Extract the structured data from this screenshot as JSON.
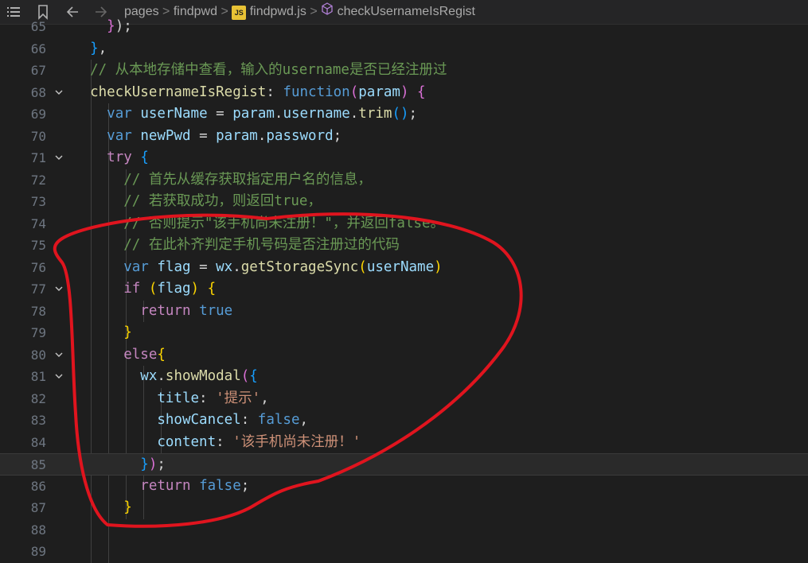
{
  "breadcrumb": {
    "items": [
      "pages",
      "findpwd",
      "findpwd.js",
      "checkUsernameIsRegist"
    ],
    "js_badge": "JS"
  },
  "editor": {
    "current_line": 85,
    "lines": [
      {
        "n": 65,
        "fold": false,
        "tokens": [
          [
            "punc",
            "    "
          ],
          [
            "br1",
            "}"
          ],
          [
            "punc",
            ");"
          ]
        ]
      },
      {
        "n": 66,
        "fold": false,
        "tokens": [
          [
            "punc",
            "  "
          ],
          [
            "br3",
            "}"
          ],
          [
            "punc",
            ","
          ]
        ]
      },
      {
        "n": 67,
        "fold": false,
        "tokens": [
          [
            "punc",
            "  "
          ],
          [
            "cmt",
            "// 从本地存储中查看，输入的username是否已经注册过"
          ]
        ]
      },
      {
        "n": 68,
        "fold": true,
        "tokens": [
          [
            "punc",
            "  "
          ],
          [
            "fn",
            "checkUsernameIsRegist"
          ],
          [
            "punc",
            ": "
          ],
          [
            "kw",
            "function"
          ],
          [
            "br1",
            "("
          ],
          [
            "var",
            "param"
          ],
          [
            "br1",
            ")"
          ],
          [
            "punc",
            " "
          ],
          [
            "br1",
            "{"
          ]
        ]
      },
      {
        "n": 69,
        "fold": false,
        "tokens": [
          [
            "punc",
            "    "
          ],
          [
            "kw",
            "var"
          ],
          [
            "punc",
            " "
          ],
          [
            "var",
            "userName"
          ],
          [
            "punc",
            " = "
          ],
          [
            "var",
            "param"
          ],
          [
            "punc",
            "."
          ],
          [
            "prop",
            "username"
          ],
          [
            "punc",
            "."
          ],
          [
            "fn",
            "trim"
          ],
          [
            "br3",
            "()"
          ],
          [
            "punc",
            ";"
          ]
        ]
      },
      {
        "n": 70,
        "fold": false,
        "tokens": [
          [
            "punc",
            "    "
          ],
          [
            "kw",
            "var"
          ],
          [
            "punc",
            " "
          ],
          [
            "var",
            "newPwd"
          ],
          [
            "punc",
            " = "
          ],
          [
            "var",
            "param"
          ],
          [
            "punc",
            "."
          ],
          [
            "prop",
            "password"
          ],
          [
            "punc",
            ";"
          ]
        ]
      },
      {
        "n": 71,
        "fold": true,
        "tokens": [
          [
            "punc",
            "    "
          ],
          [
            "kw2",
            "try"
          ],
          [
            "punc",
            " "
          ],
          [
            "br3",
            "{"
          ]
        ]
      },
      {
        "n": 72,
        "fold": false,
        "tokens": [
          [
            "punc",
            "      "
          ],
          [
            "cmt",
            "// 首先从缓存获取指定用户名的信息，"
          ]
        ]
      },
      {
        "n": 73,
        "fold": false,
        "tokens": [
          [
            "punc",
            "      "
          ],
          [
            "cmt",
            "// 若获取成功，则返回true，"
          ]
        ]
      },
      {
        "n": 74,
        "fold": false,
        "tokens": [
          [
            "punc",
            "      "
          ],
          [
            "cmt",
            "// 否则提示\"该手机尚未注册！\"，并返回false。"
          ]
        ]
      },
      {
        "n": 75,
        "fold": false,
        "tokens": [
          [
            "punc",
            "      "
          ],
          [
            "cmt",
            "// 在此补齐判定手机号码是否注册过的代码"
          ]
        ]
      },
      {
        "n": 76,
        "fold": false,
        "tokens": [
          [
            "punc",
            "      "
          ],
          [
            "kw",
            "var"
          ],
          [
            "punc",
            " "
          ],
          [
            "var",
            "flag"
          ],
          [
            "punc",
            " = "
          ],
          [
            "var",
            "wx"
          ],
          [
            "punc",
            "."
          ],
          [
            "fn",
            "getStorageSync"
          ],
          [
            "br2",
            "("
          ],
          [
            "var",
            "userName"
          ],
          [
            "br2",
            ")"
          ]
        ]
      },
      {
        "n": 77,
        "fold": true,
        "tokens": [
          [
            "punc",
            "      "
          ],
          [
            "kw2",
            "if"
          ],
          [
            "punc",
            " "
          ],
          [
            "br2",
            "("
          ],
          [
            "var",
            "flag"
          ],
          [
            "br2",
            ")"
          ],
          [
            "punc",
            " "
          ],
          [
            "br2",
            "{"
          ]
        ]
      },
      {
        "n": 78,
        "fold": false,
        "tokens": [
          [
            "punc",
            "        "
          ],
          [
            "kw2",
            "return"
          ],
          [
            "punc",
            " "
          ],
          [
            "bool",
            "true"
          ]
        ]
      },
      {
        "n": 79,
        "fold": false,
        "tokens": [
          [
            "punc",
            "      "
          ],
          [
            "br2",
            "}"
          ]
        ]
      },
      {
        "n": 80,
        "fold": true,
        "tokens": [
          [
            "punc",
            "      "
          ],
          [
            "kw2",
            "else"
          ],
          [
            "br2",
            "{"
          ]
        ]
      },
      {
        "n": 81,
        "fold": true,
        "tokens": [
          [
            "punc",
            "        "
          ],
          [
            "var",
            "wx"
          ],
          [
            "punc",
            "."
          ],
          [
            "fn",
            "showModal"
          ],
          [
            "br1",
            "("
          ],
          [
            "br3",
            "{"
          ]
        ]
      },
      {
        "n": 82,
        "fold": false,
        "tokens": [
          [
            "punc",
            "          "
          ],
          [
            "prop",
            "title"
          ],
          [
            "punc",
            ": "
          ],
          [
            "str",
            "'提示'"
          ],
          [
            "punc",
            ","
          ]
        ]
      },
      {
        "n": 83,
        "fold": false,
        "tokens": [
          [
            "punc",
            "          "
          ],
          [
            "prop",
            "showCancel"
          ],
          [
            "punc",
            ": "
          ],
          [
            "bool",
            "false"
          ],
          [
            "punc",
            ","
          ]
        ]
      },
      {
        "n": 84,
        "fold": false,
        "tokens": [
          [
            "punc",
            "          "
          ],
          [
            "prop",
            "content"
          ],
          [
            "punc",
            ": "
          ],
          [
            "str",
            "'该手机尚未注册！'"
          ]
        ]
      },
      {
        "n": 85,
        "fold": false,
        "tokens": [
          [
            "punc",
            "        "
          ],
          [
            "br3",
            "}"
          ],
          [
            "br1",
            ")"
          ],
          [
            "punc",
            ";"
          ]
        ]
      },
      {
        "n": 86,
        "fold": false,
        "tokens": [
          [
            "punc",
            "        "
          ],
          [
            "kw2",
            "return"
          ],
          [
            "punc",
            " "
          ],
          [
            "bool",
            "false"
          ],
          [
            "punc",
            ";"
          ]
        ]
      },
      {
        "n": 87,
        "fold": false,
        "tokens": [
          [
            "punc",
            "      "
          ],
          [
            "br2",
            "}"
          ]
        ]
      },
      {
        "n": 88,
        "fold": false,
        "tokens": []
      },
      {
        "n": 89,
        "fold": false,
        "tokens": []
      }
    ]
  }
}
